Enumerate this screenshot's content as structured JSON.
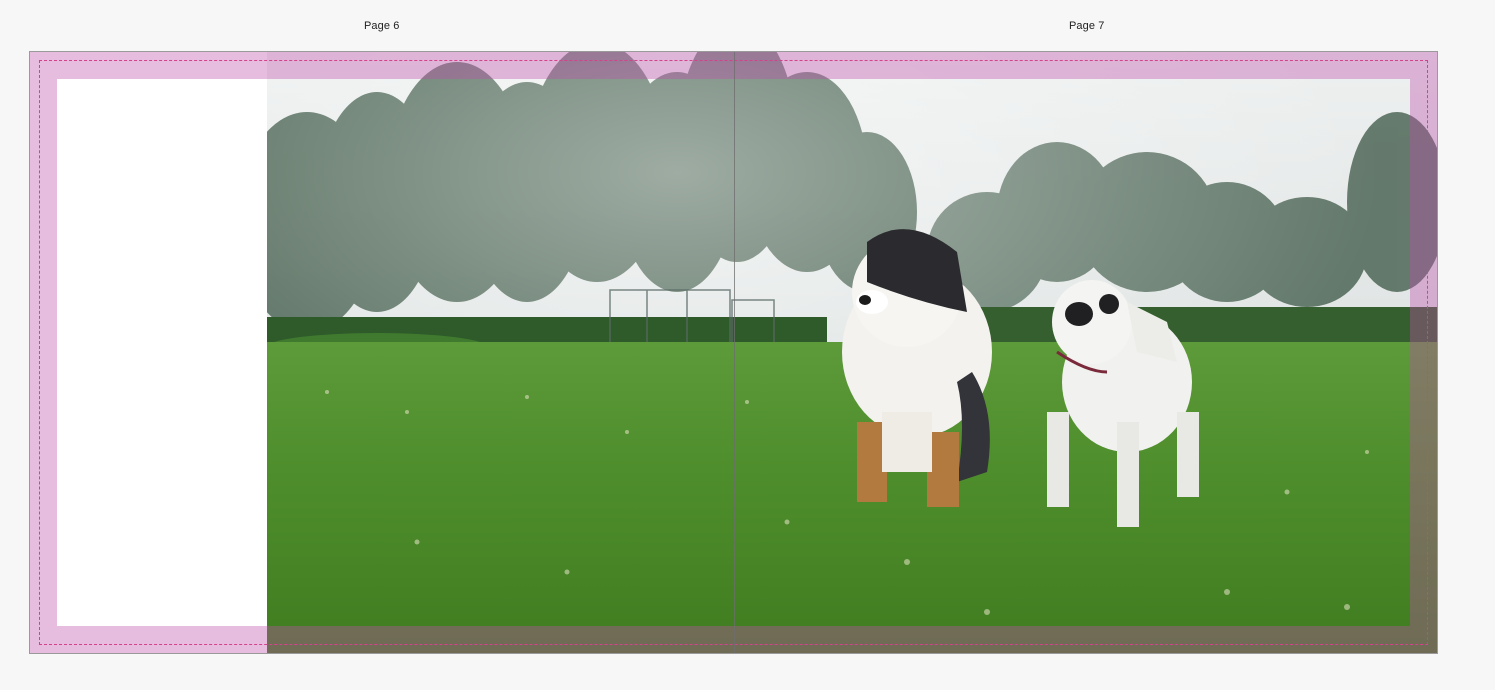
{
  "pages": {
    "left_label": "Page 6",
    "right_label": "Page 7"
  },
  "colors": {
    "background": "#f7f7f7",
    "bleed": "#d9a6d6",
    "trim_line": "#d4428d",
    "frame_border": "#9a9a9a"
  }
}
